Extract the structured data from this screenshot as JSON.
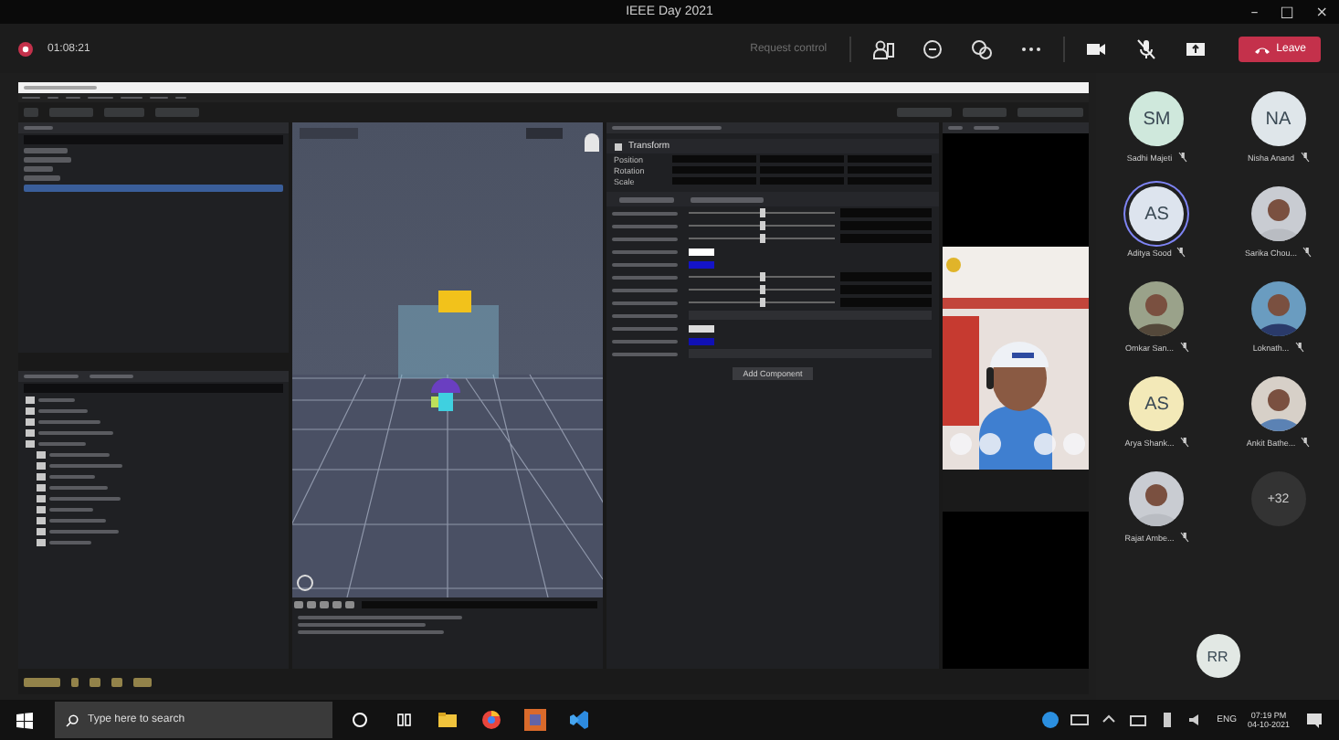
{
  "window": {
    "title": "IEEE Day 2021",
    "controls": [
      "–",
      "□",
      "×"
    ]
  },
  "meeting_bar": {
    "timer": "01:08:21",
    "request_control": "Request control",
    "leave": "Leave"
  },
  "unity": {
    "inspector": {
      "component": "Transform",
      "rows": [
        "Position",
        "Rotation",
        "Scale"
      ],
      "sliders": [
        {
          "level": 0.5
        },
        {
          "level": 0.5
        },
        {
          "level": 0.5
        },
        {
          "level": 0.5
        },
        {
          "level": 0.5
        },
        {
          "level": 0.5
        }
      ],
      "swatches": [
        {
          "color": "#ffffff"
        },
        {
          "color": "#1414c8"
        },
        {
          "color": "#dcdcdc"
        },
        {
          "color": "#1010b4"
        }
      ],
      "add_button": "Add Component"
    }
  },
  "participants": [
    {
      "kind": "initials",
      "initials": "SM",
      "name": "Sadhi Majeti",
      "color": "#cfe8dc",
      "speaking": false
    },
    {
      "kind": "initials",
      "initials": "NA",
      "name": "Nisha Anand",
      "color": "#dfe6ea",
      "speaking": false
    },
    {
      "kind": "initials",
      "initials": "AS",
      "name": "Aditya Sood",
      "color": "#dde4ee",
      "speaking": true
    },
    {
      "name": "Sarika Chou...",
      "speaking": false
    },
    {
      "name": "Omkar San...",
      "speaking": false
    },
    {
      "name": "Loknath...",
      "speaking": false
    },
    {
      "kind": "initials",
      "initials": "AS",
      "name": "Arya Shank...",
      "color": "#f3e9b8",
      "speaking": false
    },
    {
      "name": "Ankit Bathe...",
      "speaking": false
    },
    {
      "name": "Rajat Ambe...",
      "speaking": false
    },
    {
      "kind": "overflow",
      "initials": "+32",
      "speaking": false
    }
  ],
  "self": {
    "initials": "RR"
  },
  "taskbar": {
    "search_placeholder": "Type here to search",
    "language": "ENG",
    "time": "07:19 PM",
    "date": "04-10-2021"
  }
}
